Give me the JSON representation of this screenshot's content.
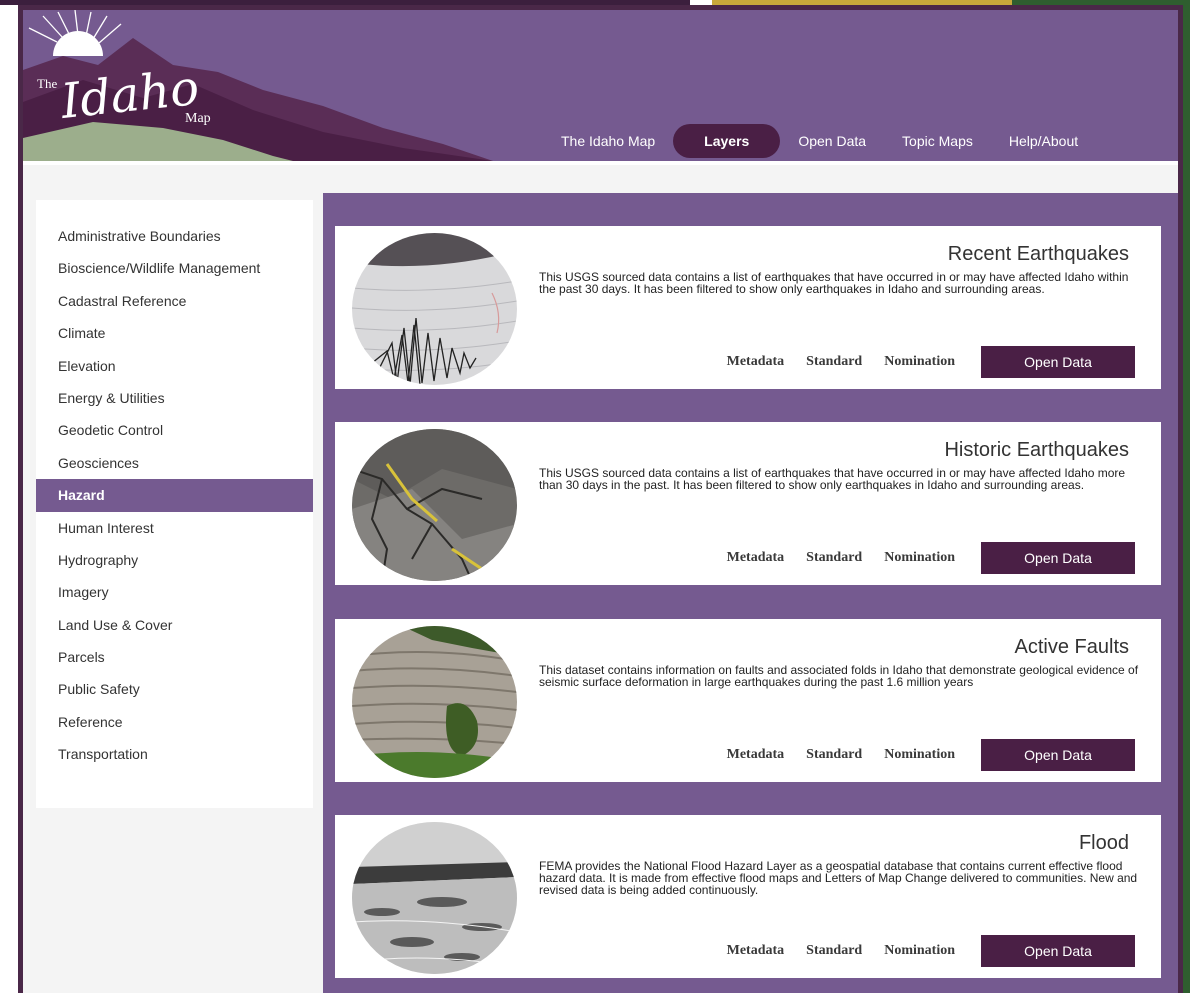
{
  "logo": {
    "the": "The",
    "idaho": "Idaho",
    "map": "Map"
  },
  "nav": {
    "items": [
      {
        "label": "The Idaho Map"
      },
      {
        "label": "Layers"
      },
      {
        "label": "Open Data"
      },
      {
        "label": "Topic Maps"
      },
      {
        "label": "Help/About"
      }
    ],
    "active": "Layers"
  },
  "sidebar": {
    "items": [
      {
        "label": "Administrative Boundaries"
      },
      {
        "label": "Bioscience/Wildlife Management"
      },
      {
        "label": "Cadastral Reference"
      },
      {
        "label": "Climate"
      },
      {
        "label": "Elevation"
      },
      {
        "label": "Energy & Utilities"
      },
      {
        "label": "Geodetic Control"
      },
      {
        "label": "Geosciences"
      },
      {
        "label": "Hazard"
      },
      {
        "label": "Human Interest"
      },
      {
        "label": "Hydrography"
      },
      {
        "label": "Imagery"
      },
      {
        "label": "Land Use & Cover"
      },
      {
        "label": "Parcels"
      },
      {
        "label": "Public Safety"
      },
      {
        "label": "Reference"
      },
      {
        "label": "Transportation"
      }
    ],
    "active": "Hazard"
  },
  "cards": [
    {
      "title": "Recent Earthquakes",
      "description": "This USGS sourced data contains a list of earthquakes that have occurred in or may have affected Idaho within the past 30 days. It has been filtered to show only earthquakes in Idaho and surrounding areas.",
      "image_icon": "seismograph-photo"
    },
    {
      "title": "Historic Earthquakes",
      "description": "This USGS sourced data contains a list of earthquakes that have occurred in or may have affected Idaho more than 30 days in the past. It has been filtered to show only earthquakes in Idaho and surrounding areas.",
      "image_icon": "cracked-road-photo"
    },
    {
      "title": "Active Faults",
      "description": "This dataset contains information on faults and associated folds in Idaho that demonstrate geological evidence of seismic surface deformation in large earthquakes during the past 1.6 million years",
      "image_icon": "rock-cliff-photo"
    },
    {
      "title": "Flood",
      "description": "FEMA provides the National Flood Hazard Layer as a geospatial database that contains current effective flood hazard data. It is made from effective flood maps and Letters of Map Change delivered to communities. New and revised data is being added continuously.",
      "image_icon": "flooded-field-photo"
    }
  ],
  "card_actions": {
    "metadata": "Metadata",
    "standard": "Standard",
    "nomination": "Nomination",
    "open_data": "Open Data"
  },
  "colors": {
    "header_purple": "#755a90",
    "dark_plum": "#4a1f45",
    "frame_border": "#4a2848",
    "accent_green": "#2f5e2f",
    "accent_gold": "#c8a93a"
  }
}
